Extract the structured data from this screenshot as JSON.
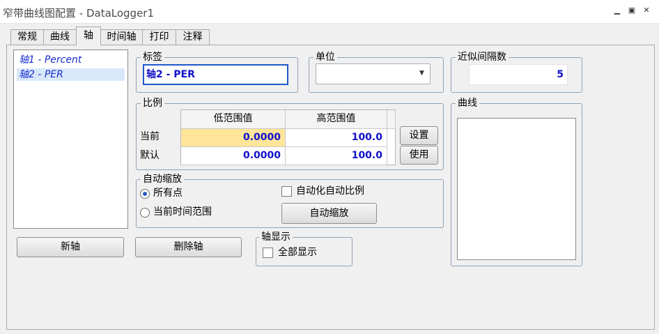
{
  "window": {
    "title": "窄带曲线图配置 - DataLogger1",
    "minimize_glyph": "▁",
    "restore_glyph": "▣",
    "close_glyph": "✕"
  },
  "tabs": [
    "常规",
    "曲线",
    "轴",
    "时间轴",
    "打印",
    "注释"
  ],
  "active_tab": "轴",
  "axis_list": {
    "items": [
      "轴1 - Percent",
      "轴2 - PER"
    ],
    "selected": "轴2 - PER"
  },
  "label_group": {
    "title": "标签",
    "value": "轴2 - PER"
  },
  "unit_group": {
    "title": "单位",
    "value": ""
  },
  "interval_group": {
    "title": "近似间隔数",
    "value": "5"
  },
  "scale_group": {
    "title": "比例",
    "columns": [
      "低范围值",
      "高范围值"
    ],
    "rows": [
      {
        "label": "当前",
        "low": "0.0000",
        "high": "100.0"
      },
      {
        "label": "默认",
        "low": "0.0000",
        "high": "100.0"
      }
    ],
    "set_button": "设置",
    "use_button": "使用"
  },
  "autoscale_group": {
    "title": "自动缩放",
    "radio_all": "所有点",
    "radio_time": "当前时间范围",
    "auto_checkbox": "自动化自动比例",
    "autoscale_button": "自动缩放"
  },
  "curve_group": {
    "title": "曲线"
  },
  "axis_display_group": {
    "title": "轴显示",
    "show_all": "全部显示"
  },
  "buttons": {
    "new_axis": "新轴",
    "delete_axis": "删除轴"
  },
  "colors": {
    "value_text": "#1010c8",
    "axis_item_text": "#1a2fd0",
    "current_low_highlight": "#ffe599"
  }
}
